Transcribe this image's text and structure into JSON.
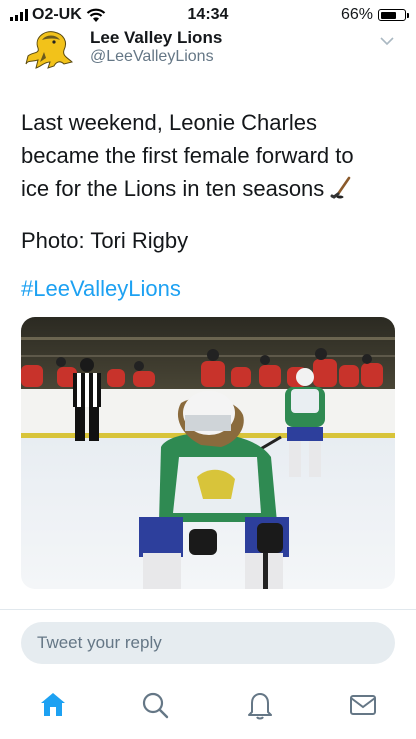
{
  "status_bar": {
    "carrier": "O2-UK",
    "time": "14:34",
    "battery": "66%",
    "battery_level": 0.66
  },
  "profile": {
    "name": "Lee Valley Lions",
    "handle": "@LeeValleyLions"
  },
  "tweet": {
    "lines": [
      "Last weekend, Leonie Charles",
      "became the first female forward to",
      "ice for the Lions in ten seasons"
    ],
    "credit": "Photo: Tori Rigby",
    "hashtag": "#LeeValleyLions"
  },
  "reply": {
    "placeholder": "Tweet your reply"
  },
  "colors": {
    "accent": "#1da1f2",
    "muted": "#657786",
    "reply_bg": "#e6ecf0"
  },
  "icons": {
    "caret": "chevron-down-icon",
    "home": "home-icon",
    "search": "search-icon",
    "notifications": "bell-icon",
    "messages": "envelope-icon"
  }
}
